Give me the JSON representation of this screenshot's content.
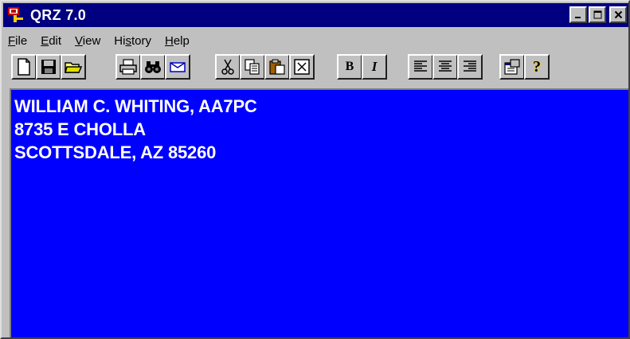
{
  "window": {
    "title": "QRZ 7.0",
    "controls": {
      "minimize": "_",
      "maximize": "□",
      "close": "✕"
    }
  },
  "menu": {
    "items": [
      {
        "pre": "",
        "ul": "F",
        "post": "ile"
      },
      {
        "pre": "",
        "ul": "E",
        "post": "dit"
      },
      {
        "pre": "",
        "ul": "V",
        "post": "iew"
      },
      {
        "pre": "Hi",
        "ul": "s",
        "post": "tory"
      },
      {
        "pre": "",
        "ul": "H",
        "post": "elp"
      }
    ]
  },
  "toolbar": {
    "buttons": [
      {
        "icon": "new-document-icon"
      },
      {
        "icon": "save-disk-icon"
      },
      {
        "icon": "open-folder-icon"
      },
      {
        "icon": "print-icon"
      },
      {
        "icon": "binoculars-find-icon"
      },
      {
        "icon": "envelope-icon"
      },
      {
        "icon": "scissors-cut-icon"
      },
      {
        "icon": "copy-icon"
      },
      {
        "icon": "paste-icon"
      },
      {
        "icon": "delete-x-icon"
      },
      {
        "icon": "bold-icon",
        "label": "B"
      },
      {
        "icon": "italic-icon",
        "label": "I"
      },
      {
        "icon": "align-left-icon"
      },
      {
        "icon": "align-center-icon"
      },
      {
        "icon": "align-right-icon"
      },
      {
        "icon": "properties-icon"
      },
      {
        "icon": "help-question-icon",
        "label": "?"
      }
    ]
  },
  "client": {
    "background": "#0000ff",
    "text_color": "#ffffff",
    "address_lines": [
      "WILLIAM C. WHITING, AA7PC",
      "8735 E CHOLLA",
      "SCOTTSDALE, AZ  85260"
    ]
  },
  "colors": {
    "titlebar": "#000080",
    "chrome": "#c0c0c0"
  }
}
